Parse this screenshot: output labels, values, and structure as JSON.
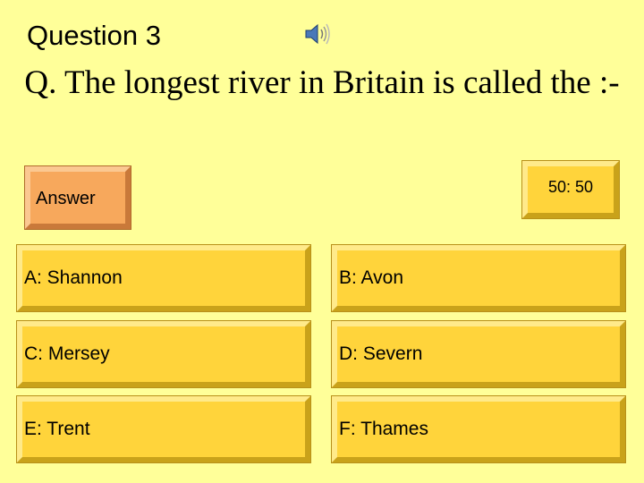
{
  "slide": {
    "title": "Question 3",
    "question": "Q. The longest river in Britain is called the :-",
    "speaker_icon": "speaker-icon"
  },
  "buttons": {
    "answer_label": "Answer",
    "fifty_fifty_label": "50: 50"
  },
  "options": [
    {
      "label": "A: Shannon"
    },
    {
      "label": "B: Avon"
    },
    {
      "label": "C: Mersey"
    },
    {
      "label": "D: Severn"
    },
    {
      "label": "E: Trent"
    },
    {
      "label": "F: Thames"
    }
  ],
  "colors": {
    "background": "#ffff99",
    "option_fill": "#ffd43b",
    "answer_fill": "#f7a85c"
  }
}
